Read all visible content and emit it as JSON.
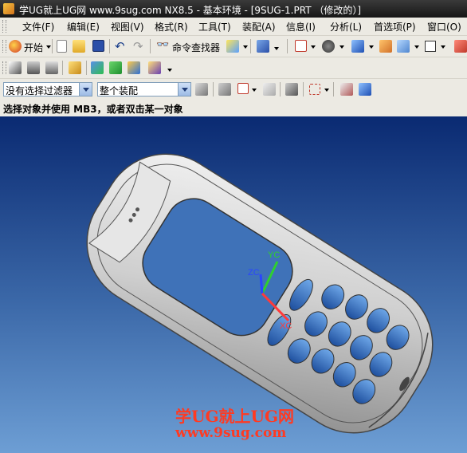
{
  "window": {
    "title": "学UG就上UG网 www.9sug.com NX8.5 - 基本环境 - [9SUG-1.PRT （修改的）]"
  },
  "menu": [
    "文件(F)",
    "编辑(E)",
    "视图(V)",
    "格式(R)",
    "工具(T)",
    "装配(A)",
    "信息(I)",
    "分析(L)",
    "首选项(P)",
    "窗口(O)"
  ],
  "toolbar": {
    "start_label": "开始",
    "command_finder_label": "命令查找器"
  },
  "filter": {
    "type_filter_value": "没有选择过滤器",
    "scope_value": "整个装配"
  },
  "status": {
    "prompt": "选择对象并使用 MB3，或者双击某一对象"
  },
  "viewport": {
    "axis_labels": {
      "zc": "ZC",
      "yc": "YC",
      "xc": "XC"
    },
    "axis_colors": {
      "zc": "#2a45ff",
      "yc": "#2fcf2f",
      "xc": "#ff3a3a"
    }
  },
  "watermark": {
    "line1": "学UG就上UG网",
    "line2": "www.9sug.com"
  }
}
